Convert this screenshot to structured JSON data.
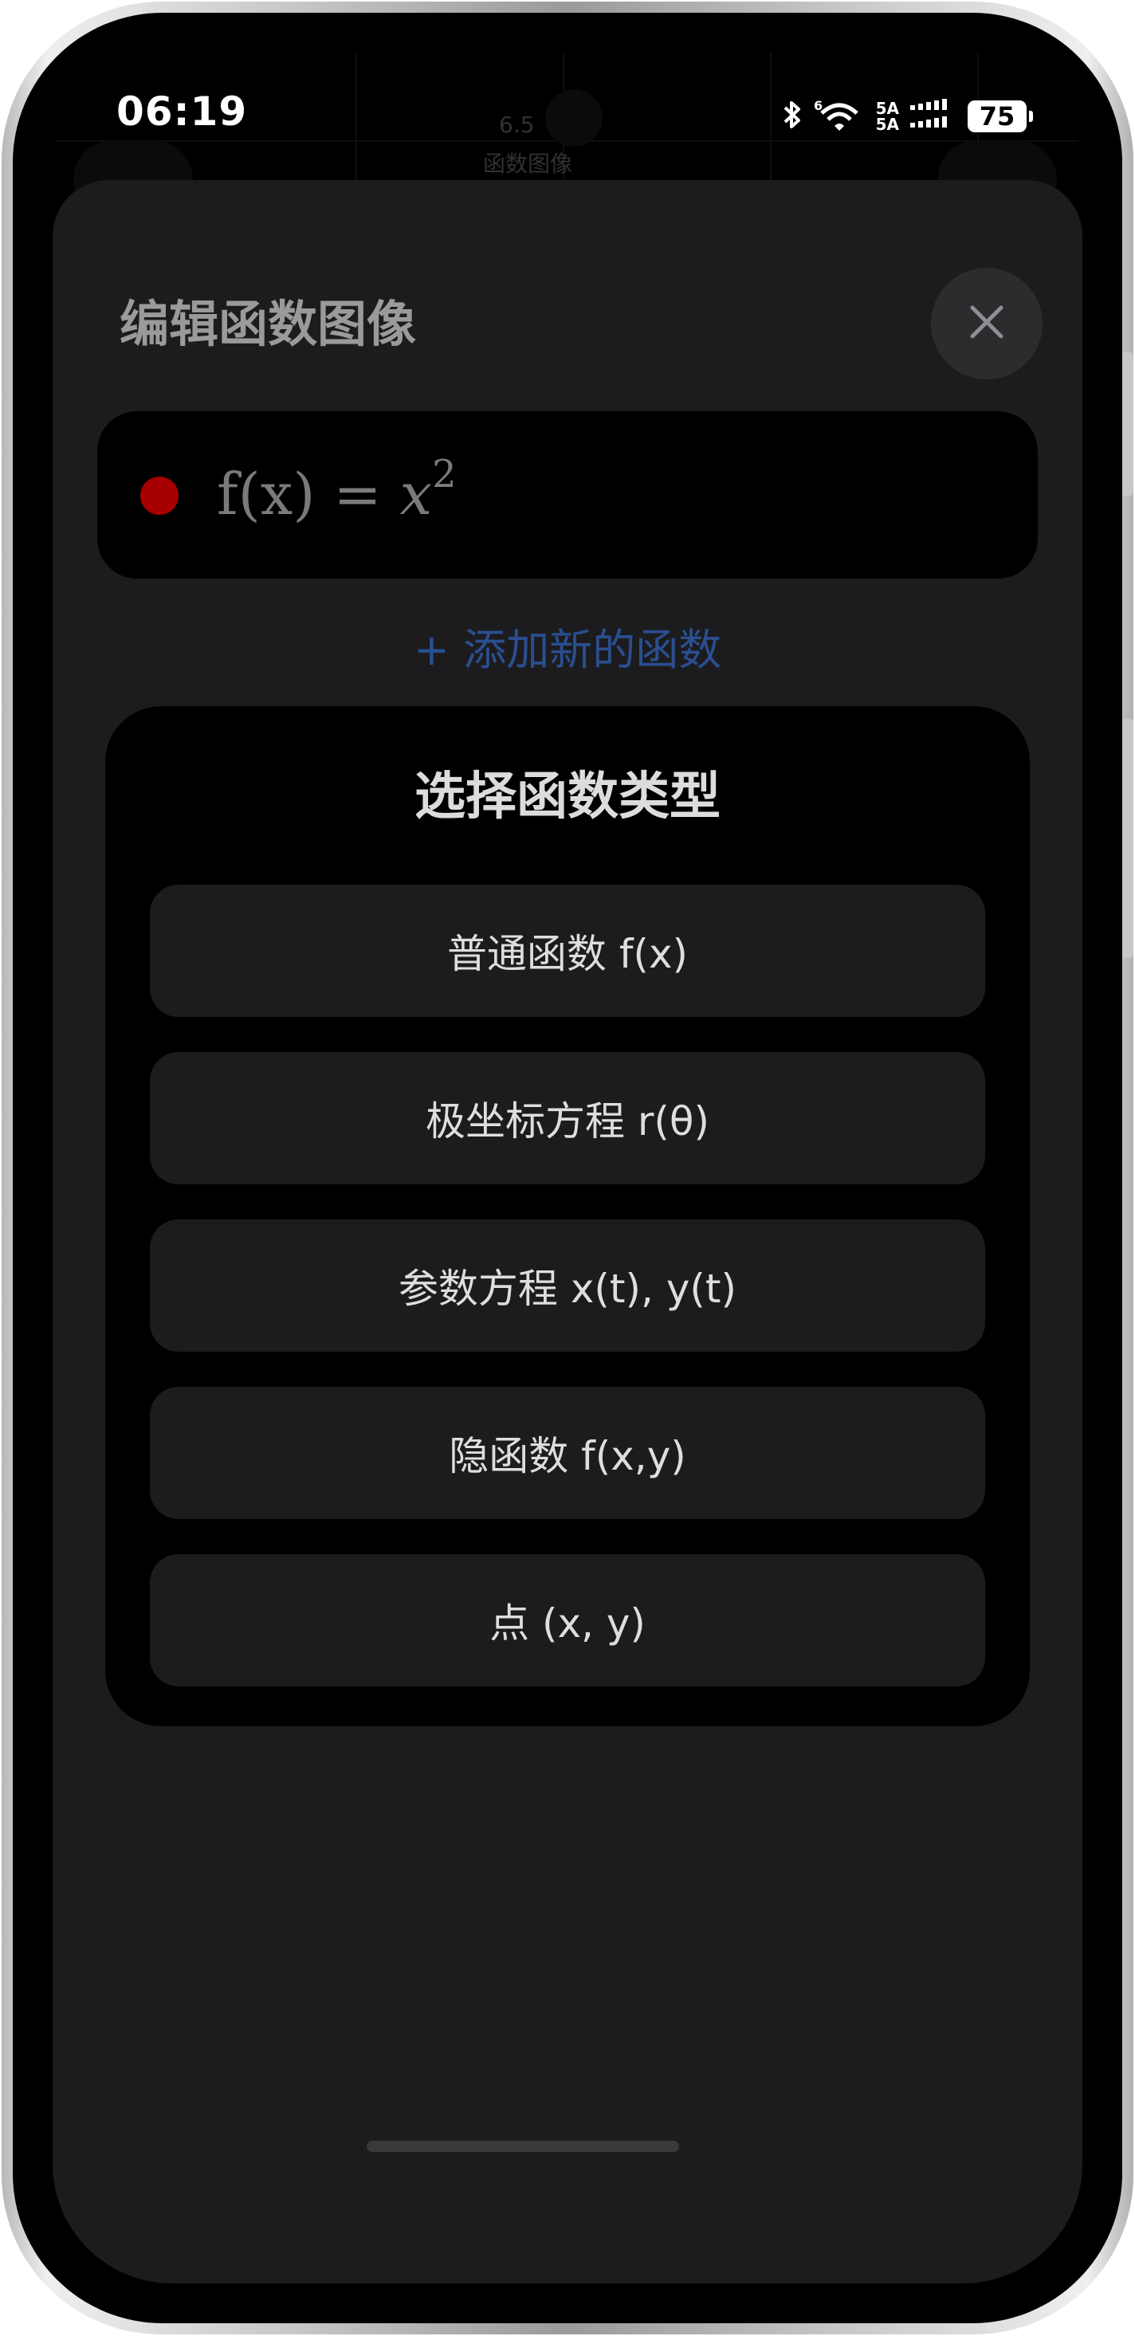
{
  "status_bar": {
    "time": "06:19",
    "network_top": "5A",
    "network_bottom": "5A",
    "battery": "75"
  },
  "background_app": {
    "value_text": "6.5",
    "title_text": "函数图像"
  },
  "sheet": {
    "title": "编辑函数图像",
    "functions": [
      {
        "color": "#a80000",
        "prefix": "f(x) = ",
        "variable": "x",
        "exponent": "2"
      }
    ],
    "add_function_label": "+ 添加新的函数"
  },
  "type_picker": {
    "title": "选择函数类型",
    "options": [
      {
        "label": "普通函数 f(x)"
      },
      {
        "label": "极坐标方程 r(θ)"
      },
      {
        "label": "参数方程 x(t), y(t)"
      },
      {
        "label": "隐函数 f(x,y)"
      },
      {
        "label": "点 (x, y)"
      }
    ]
  },
  "icons": {
    "close": "close-icon",
    "bluetooth": "bluetooth-icon",
    "wifi": "wifi-icon",
    "signal": "signal-icon",
    "battery": "battery-icon"
  },
  "colors": {
    "sheet_background": "#1c1c1e",
    "card_background": "#000000",
    "link": "#2a4e90",
    "function_dot": "#a80000"
  }
}
